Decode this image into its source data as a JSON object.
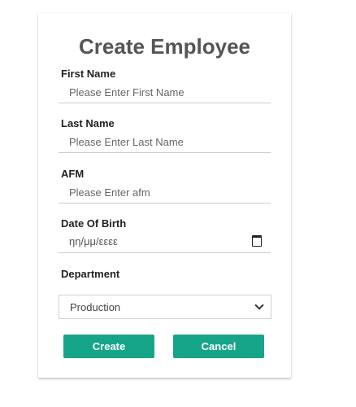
{
  "form": {
    "title": "Create Employee",
    "fields": [
      {
        "label": "First Name",
        "placeholder": "Please Enter First Name",
        "value": ""
      },
      {
        "label": "Last Name",
        "placeholder": "Please Enter Last Name",
        "value": ""
      },
      {
        "label": "AFM",
        "placeholder": "Please Enter afm",
        "value": ""
      }
    ],
    "date_of_birth": {
      "label": "Date Of Birth",
      "placeholder": "ηη/μμ/εεεε",
      "icon": "calendar-icon"
    },
    "department": {
      "label": "Department",
      "selected": "Production",
      "icon": "chevron-down-icon"
    },
    "buttons": {
      "create": "Create",
      "cancel": "Cancel"
    },
    "colors": {
      "accent": "#17a589",
      "title": "#555555"
    }
  }
}
